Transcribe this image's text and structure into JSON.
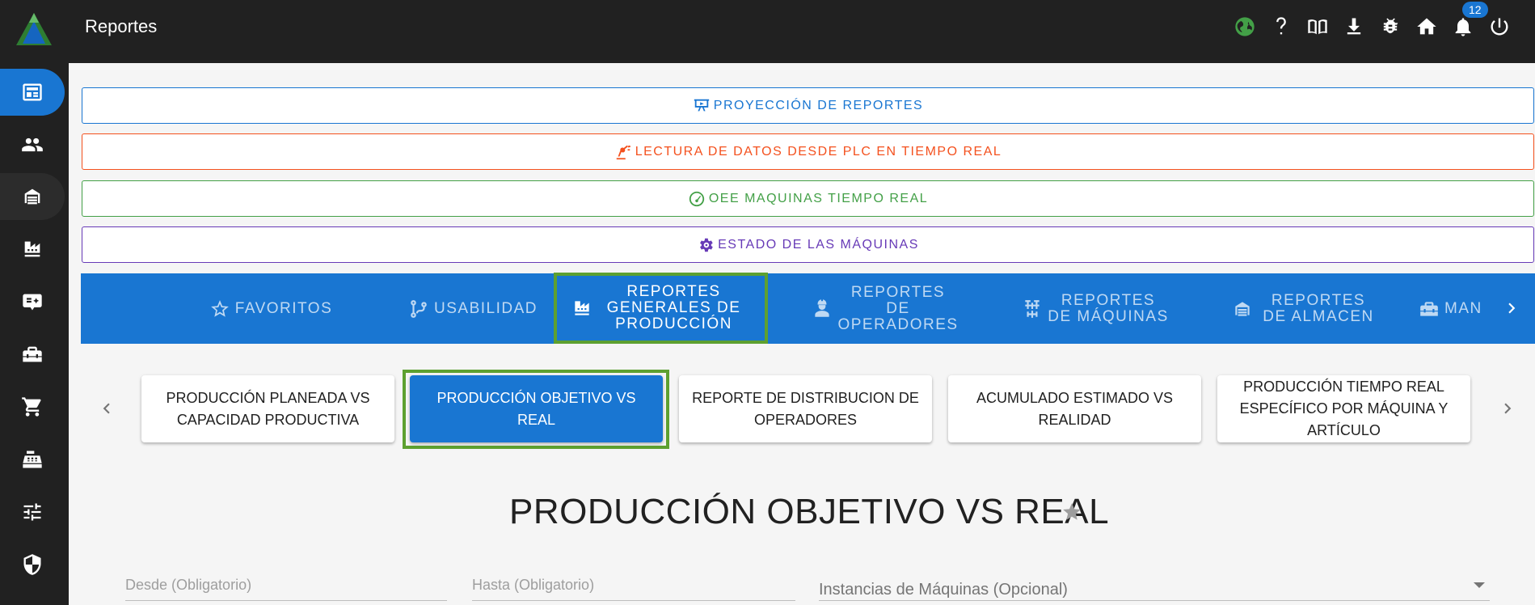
{
  "app": {
    "title": "Reportes",
    "notifications_count": "12"
  },
  "top_icons": [
    "globe-icon",
    "help-icon",
    "book-icon",
    "download-icon",
    "bug-icon",
    "home-icon",
    "bell-icon",
    "power-icon"
  ],
  "sidebar": {
    "items": [
      {
        "icon": "newspaper-icon",
        "active": true
      },
      {
        "icon": "users-icon"
      },
      {
        "icon": "warehouse-icon"
      },
      {
        "icon": "factory-icon"
      },
      {
        "icon": "badge-card-icon"
      },
      {
        "icon": "toolbox-icon"
      },
      {
        "icon": "cart-icon"
      },
      {
        "icon": "cash-register-icon"
      },
      {
        "icon": "sliders-icon"
      },
      {
        "icon": "shield-icon"
      }
    ]
  },
  "quick_links": {
    "projection": "PROYECCIÓN DE REPORTES",
    "plc": "LECTURA DE DATOS DESDE PLC EN TIEMPO REAL",
    "oee": "OEE MAQUINAS TIEMPO REAL",
    "machines_state": "ESTADO DE LAS MÁQUINAS"
  },
  "tabs": [
    {
      "label": "FAVORITOS",
      "icon": "star-outline-icon"
    },
    {
      "label": "USABILIDAD",
      "icon": "source-branch-icon"
    },
    {
      "label": "REPORTES GENERALES DE PRODUCCIÓN",
      "icon": "factory-icon",
      "active": true
    },
    {
      "label": "REPORTES DE OPERADORES",
      "icon": "worker-icon"
    },
    {
      "label": "REPORTES DE MÁQUINAS",
      "icon": "machine-icon"
    },
    {
      "label": "REPORTES DE ALMACEN",
      "icon": "warehouse-icon"
    },
    {
      "label": "MAN",
      "icon": "toolbox-icon"
    }
  ],
  "cards": [
    {
      "label": "PRODUCCIÓN PLANEADA VS CAPACIDAD PRODUCTIVA"
    },
    {
      "label": "PRODUCCIÓN OBJETIVO VS REAL",
      "active": true
    },
    {
      "label": "REPORTE DE DISTRIBUCION DE OPERADORES"
    },
    {
      "label": "ACUMULADO ESTIMADO VS REALIDAD"
    },
    {
      "label": "PRODUCCIÓN TIEMPO REAL ESPECÍFICO POR MÁQUINA Y ARTÍCULO"
    }
  ],
  "report": {
    "title": "PRODUCCIÓN OBJETIVO VS REAL",
    "fields": {
      "from_placeholder": "Desde (Obligatorio)",
      "to_placeholder": "Hasta (Obligatorio)",
      "machines_placeholder": "Instancias de Máquinas (Opcional)"
    }
  },
  "colors": {
    "primary": "#1976d2",
    "highlight": "#5da030",
    "orange": "#f4511e",
    "green": "#43a047",
    "purple": "#673ab7",
    "topbar": "#212121"
  }
}
